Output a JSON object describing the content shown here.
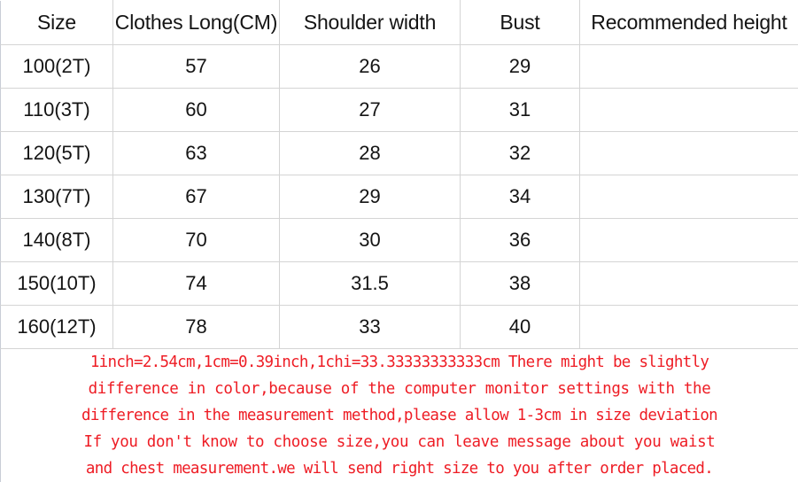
{
  "table": {
    "columns": [
      "Size",
      "Clothes Long(CM)",
      "Shoulder width",
      "Bust",
      "Recommended height"
    ],
    "rows": [
      {
        "size": "100(2T)",
        "clothes_long": "57",
        "shoulder_width": "26",
        "bust": "29",
        "recommended_height": ""
      },
      {
        "size": "110(3T)",
        "clothes_long": "60",
        "shoulder_width": "27",
        "bust": "31",
        "recommended_height": ""
      },
      {
        "size": "120(5T)",
        "clothes_long": "63",
        "shoulder_width": "28",
        "bust": "32",
        "recommended_height": ""
      },
      {
        "size": "130(7T)",
        "clothes_long": "67",
        "shoulder_width": "29",
        "bust": "34",
        "recommended_height": ""
      },
      {
        "size": "140(8T)",
        "clothes_long": "70",
        "shoulder_width": "30",
        "bust": "36",
        "recommended_height": ""
      },
      {
        "size": "150(10T)",
        "clothes_long": "74",
        "shoulder_width": "31.5",
        "bust": "38",
        "recommended_height": ""
      },
      {
        "size": "160(12T)",
        "clothes_long": "78",
        "shoulder_width": "33",
        "bust": "40",
        "recommended_height": ""
      }
    ]
  },
  "notes": {
    "color": "#ee1c24",
    "lines": [
      "1inch=2.54cm,1cm=0.39inch,1chi=33.33333333333cm There might be slightly",
      "difference in color,because of the computer monitor settings with the",
      "difference in the measurement method,please allow 1-3cm in size deviation",
      "If you don't know to choose size,you can leave message about you waist",
      "and chest measurement.we will send right size to you after order placed."
    ]
  }
}
